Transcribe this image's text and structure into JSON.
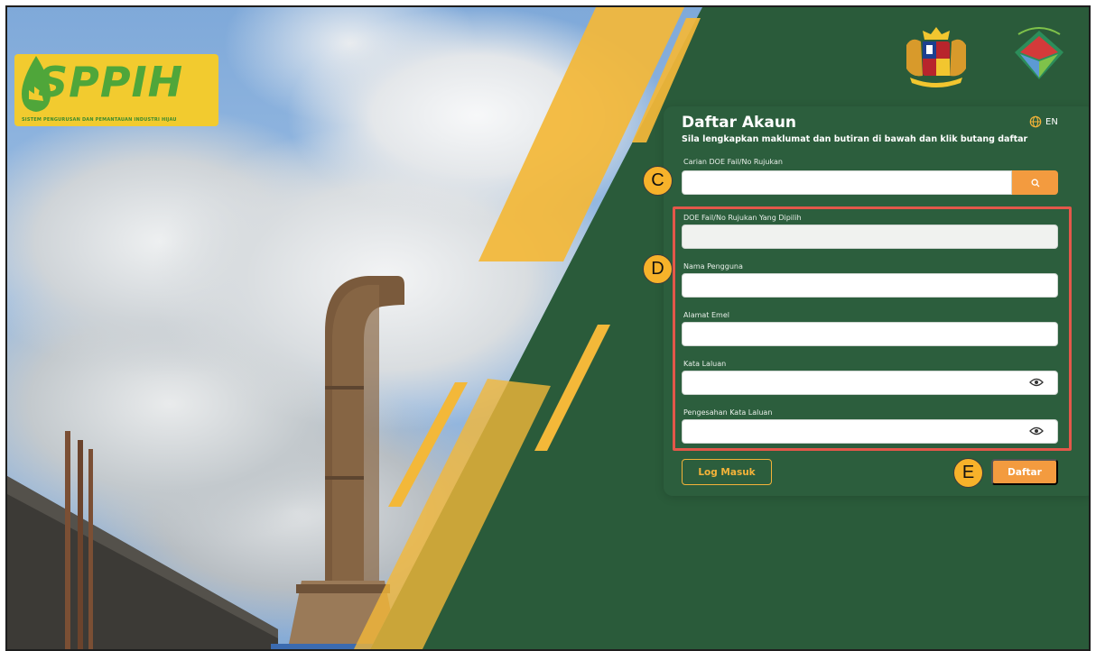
{
  "brand": {
    "logo_text": "SPPIH",
    "logo_subtitle": "SISTEM PENGURUSAN DAN PEMANTAUAN INDUSTRI HIJAU",
    "emblem_1": "malaysia-coat-of-arms-icon",
    "emblem_2": "doe-emblem-icon"
  },
  "form": {
    "title": "Daftar Akaun",
    "subtitle": "Sila lengkapkan maklumat dan butiran di bawah dan klik butang daftar",
    "language_label": "EN",
    "search": {
      "label": "Carian DOE Fail/No Rujukan",
      "value": "",
      "icon": "search-icon"
    },
    "fields": {
      "selected_ref": {
        "label": "DOE Fail/No Rujukan Yang Dipilih",
        "value": ""
      },
      "username": {
        "label": "Nama Pengguna",
        "value": ""
      },
      "email": {
        "label": "Alamat Emel",
        "value": ""
      },
      "password": {
        "label": "Kata Laluan",
        "value": ""
      },
      "confirm_password": {
        "label": "Pengesahan Kata Laluan",
        "value": ""
      }
    },
    "login_button": "Log Masuk",
    "register_button": "Daftar"
  },
  "annotations": {
    "c": "C",
    "d": "D",
    "e": "E"
  },
  "colors": {
    "background_green": "#2a5b3a",
    "panel_green": "#2c5e3d",
    "accent_orange": "#f39b3f",
    "accent_yellow": "#f3b339",
    "highlight_red": "#e4574a"
  }
}
